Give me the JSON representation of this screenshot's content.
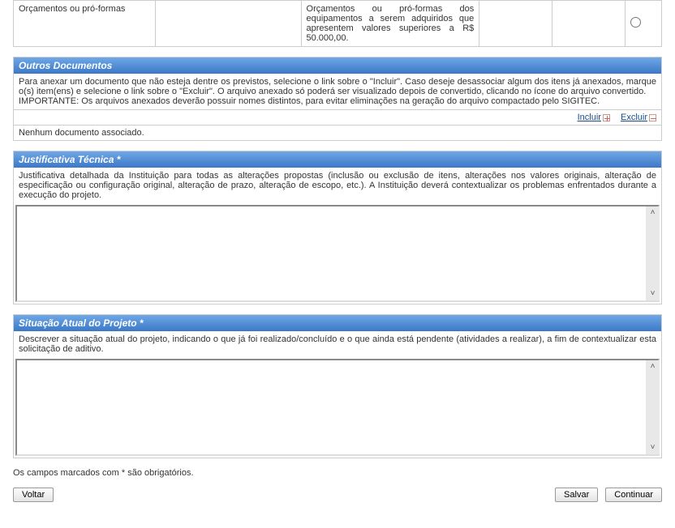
{
  "top_table": {
    "row_label": "Orçamentos ou pró-formas",
    "row_desc": "Orçamentos ou pró-formas dos equipamentos a serem adquiridos que apresentem valores superiores a R$ 50.000,00."
  },
  "outros_docs": {
    "header": "Outros Documentos",
    "body": "Para anexar um documento que não esteja dentre os previstos, selecione o link sobre o \"Incluir\". Caso deseje desassociar algum dos itens já anexados, marque o(s) item(ens) e selecione o link sobre o \"Excluir\". O arquivo anexado só poderá ser visualizado depois de convertido, clicando no ícone do arquivo convertido.",
    "important": "IMPORTANTE: Os arquivos anexados deverão possuir nomes distintos, para evitar eliminações na geração do arquivo compactado pelo SIGITEC.",
    "incluir": "Incluir",
    "excluir": "Excluir",
    "empty": "Nenhum documento associado."
  },
  "justificativa": {
    "header": "Justificativa Técnica *",
    "body": "Justificativa detalhada da Instituição para todas as alterações propostas (inclusão ou exclusão de itens, alterações nos valores originais, alteração de especificação ou configuração original, alteração de prazo, alteração de escopo, etc.). A Instituição deverá contextualizar os problemas enfrentados durante a execução do projeto."
  },
  "situacao": {
    "header": "Situação Atual do Projeto *",
    "body": "Descrever a situação atual do projeto, indicando o que já foi realizado/concluído e o que ainda está pendente (atividades a realizar), a fim de contextualizar esta solicitação de aditivo."
  },
  "required_note": "Os campos marcados com * são obrigatórios.",
  "buttons": {
    "voltar": "Voltar",
    "salvar": "Salvar",
    "continuar": "Continuar"
  }
}
